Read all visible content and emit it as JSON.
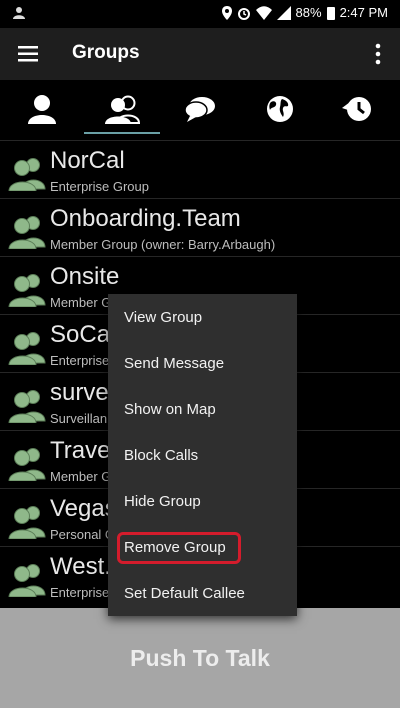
{
  "status": {
    "battery": "88%",
    "time": "2:47 PM"
  },
  "header": {
    "title": "Groups"
  },
  "tabs": [
    {
      "icon": "person-icon"
    },
    {
      "icon": "group-icon",
      "selected": true
    },
    {
      "icon": "chat-icon"
    },
    {
      "icon": "globe-icon"
    },
    {
      "icon": "history-icon"
    }
  ],
  "groups": [
    {
      "name": "NorCal",
      "type": "Enterprise Group"
    },
    {
      "name": "Onboarding.Team",
      "type": "Member Group (owner: Barry.Arbaugh)"
    },
    {
      "name": "Onsite",
      "type": "Member G"
    },
    {
      "name": "SoCa",
      "type": "Enterprise"
    },
    {
      "name": "surve",
      "type": "Surveillan"
    },
    {
      "name": "Trave",
      "type": "Member G"
    },
    {
      "name": "Vegas",
      "type": "Personal G"
    },
    {
      "name": "West.",
      "type": "Enterprise"
    }
  ],
  "context_menu": {
    "items": [
      "View Group",
      "Send Message",
      "Show on Map",
      "Block Calls",
      "Hide Group",
      "Remove Group",
      "Set Default Callee"
    ],
    "highlighted": "Remove Group"
  },
  "push_to_talk": {
    "label": "Push To Talk"
  },
  "colors": {
    "accent_underline": "#6aa0a6",
    "highlight_border": "#d41c2c",
    "avatar_green": "#8fb88a"
  }
}
